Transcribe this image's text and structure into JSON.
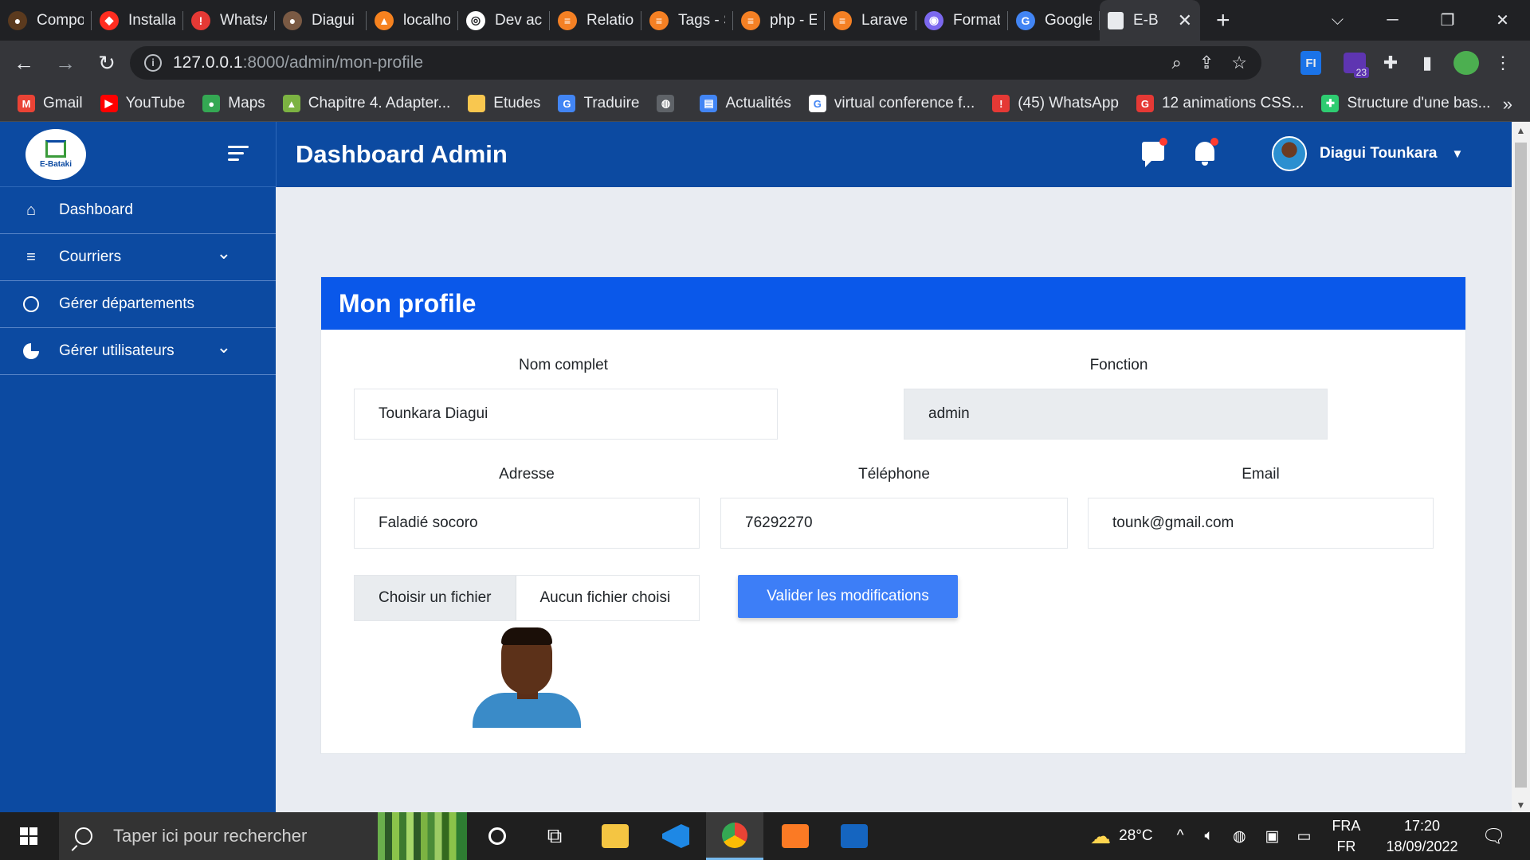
{
  "browser": {
    "tabs": [
      {
        "title": "Compo",
        "color": "#5b3a1e",
        "glyph": "●"
      },
      {
        "title": "Installa",
        "color": "#ff2d20",
        "glyph": "◆"
      },
      {
        "title": "WhatsA",
        "color": "#e53935",
        "glyph": "!"
      },
      {
        "title": "Diagui",
        "color": "#7a5a44",
        "glyph": "●"
      },
      {
        "title": "localho",
        "color": "#f6821f",
        "glyph": "▲"
      },
      {
        "title": "Dev ac",
        "color": "#ffffff",
        "glyph": "◎"
      },
      {
        "title": "Relatio",
        "color": "#f48024",
        "glyph": "≡"
      },
      {
        "title": "Tags - S",
        "color": "#f48024",
        "glyph": "≡"
      },
      {
        "title": "php - E",
        "color": "#f48024",
        "glyph": "≡"
      },
      {
        "title": "Laravel",
        "color": "#f48024",
        "glyph": "≡"
      },
      {
        "title": "Format",
        "color": "#7b68ee",
        "glyph": "◉"
      },
      {
        "title": "Google",
        "color": "#4285f4",
        "glyph": "G"
      }
    ],
    "active_tab": {
      "title": "E-B",
      "close": "✕"
    },
    "new_tab": "+",
    "window_controls": {
      "dropdown": "⌵",
      "minimize": "─",
      "restore": "❐",
      "close": "✕"
    },
    "url_host": "127.0.0.1",
    "url_path": ":8000/admin/mon-profile",
    "info": "i",
    "extension_badge": "23",
    "bookmarks": [
      {
        "label": "Gmail",
        "color": "#ea4335",
        "glyph": "M"
      },
      {
        "label": "YouTube",
        "color": "#ff0000",
        "glyph": "▶"
      },
      {
        "label": "Maps",
        "color": "#34a853",
        "glyph": "●"
      },
      {
        "label": "Chapitre 4. Adapter...",
        "color": "#7cb342",
        "glyph": "▲"
      },
      {
        "label": "Etudes",
        "color": "#f9c74f",
        "glyph": ""
      },
      {
        "label": "Traduire",
        "color": "#4285f4",
        "glyph": "G"
      },
      {
        "label": "",
        "color": "#5f6368",
        "glyph": "◍"
      },
      {
        "label": "Actualités",
        "color": "#4285f4",
        "glyph": "▤"
      },
      {
        "label": "virtual conference f...",
        "color": "#ffffff",
        "glyph": "G"
      },
      {
        "label": "(45) WhatsApp",
        "color": "#e53935",
        "glyph": "!"
      },
      {
        "label": "12 animations CSS...",
        "color": "#e53935",
        "glyph": "G"
      },
      {
        "label": "Structure d'une bas...",
        "color": "#2ecc71",
        "glyph": "✚"
      }
    ],
    "bookmarks_more": "»"
  },
  "app": {
    "logo_text": "E-Bataki",
    "header_title": "Dashboard Admin",
    "user_name": "Diagui Tounkara",
    "sidebar": [
      {
        "label": "Dashboard",
        "icon": "home-icon",
        "has_chevron": false
      },
      {
        "label": "Courriers",
        "icon": "list-icon",
        "has_chevron": true
      },
      {
        "label": "Gérer départements",
        "icon": "circle-icon",
        "has_chevron": false
      },
      {
        "label": "Gérer utilisateurs",
        "icon": "pie-chart-icon",
        "has_chevron": true
      }
    ]
  },
  "profile": {
    "title": "Mon profile",
    "labels": {
      "fullname": "Nom complet",
      "role": "Fonction",
      "address": "Adresse",
      "phone": "Téléphone",
      "email": "Email"
    },
    "values": {
      "fullname": "Tounkara Diagui",
      "role": "admin",
      "address": "Faladié socoro",
      "phone": "76292270",
      "email": "tounk@gmail.com"
    },
    "file_button": "Choisir un fichier",
    "file_status": "Aucun fichier choisi",
    "submit_label": "Valider les modifications"
  },
  "taskbar": {
    "search_placeholder": "Taper ici pour rechercher",
    "weather": "28°C",
    "lang_top": "FRA",
    "lang_bottom": "FR",
    "time": "17:20",
    "date": "18/09/2022"
  },
  "colors": {
    "sidebar_bg": "#0c4aa1",
    "card_header": "#0a58ea",
    "submit_button": "#3d7ef7"
  }
}
